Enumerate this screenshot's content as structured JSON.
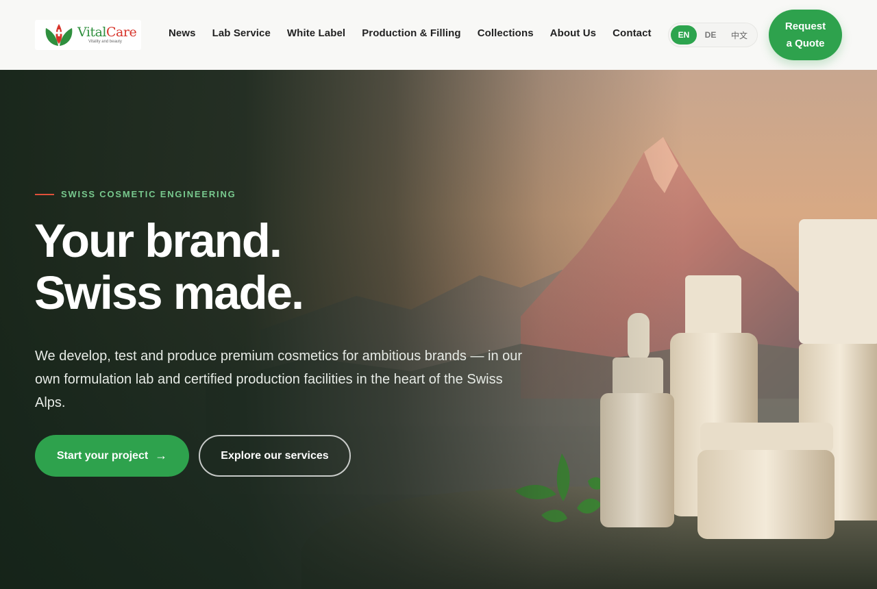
{
  "brand": {
    "name_part1": "Vital",
    "name_part2": "Care",
    "tagline": "Vitality and beauty"
  },
  "nav": {
    "items": [
      {
        "label": "News"
      },
      {
        "label": "Lab Service"
      },
      {
        "label": "White Label"
      },
      {
        "label": "Production & Filling"
      },
      {
        "label": "Collections"
      },
      {
        "label": "About Us"
      },
      {
        "label": "Contact"
      }
    ]
  },
  "language": {
    "options": [
      "EN",
      "DE",
      "中文"
    ],
    "selected": "EN"
  },
  "header": {
    "quote_line1": "Request",
    "quote_line2": "a Quote"
  },
  "hero": {
    "eyebrow": "SWISS COSMETIC ENGINEERING",
    "headline_line1": "Your brand.",
    "headline_line2": "Swiss made.",
    "lead": "We develop, test and produce premium cosmetics for ambitious brands — in our own formulation lab and certified production facilities in the heart of the Swiss Alps.",
    "cta_primary": "Start your project",
    "cta_primary_icon": "arrow-right-icon",
    "cta_secondary": "Explore our services"
  },
  "colors": {
    "accent_green": "#2ea24d",
    "eyebrow_green": "#78c98e",
    "eyebrow_line_red": "#e0513a",
    "hero_dark": "#16231a"
  }
}
